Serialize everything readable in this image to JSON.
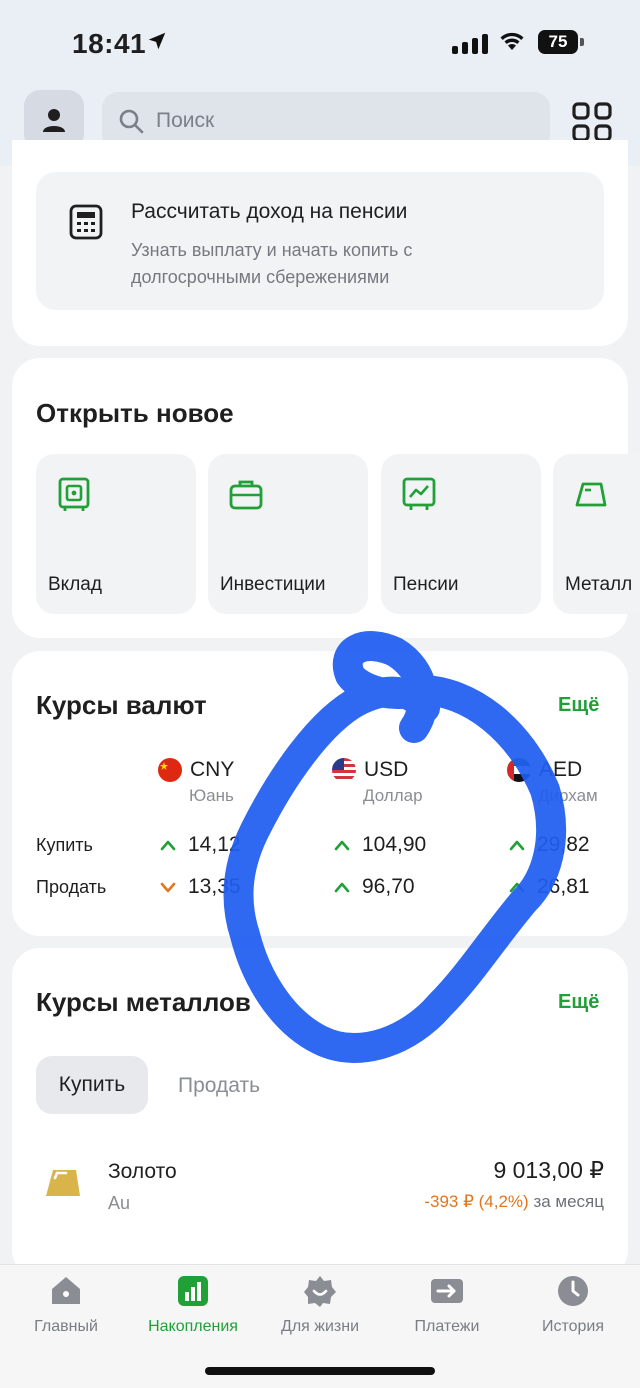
{
  "status_bar": {
    "time": "18:41",
    "battery": "75"
  },
  "header": {
    "search_placeholder": "Поиск"
  },
  "pension": {
    "title": "Рассчитать доход на пенсии",
    "subtitle": "Узнать выплату и начать копить с долгосрочными сбережениями"
  },
  "open_new": {
    "title": "Открыть новое",
    "tiles": [
      {
        "label": "Вклад",
        "icon": "safe-icon"
      },
      {
        "label": "Инвестиции",
        "icon": "briefcase-icon"
      },
      {
        "label": "Пенсии",
        "icon": "chart-icon"
      },
      {
        "label": "Металл",
        "icon": "ingot-icon"
      }
    ]
  },
  "fx": {
    "title": "Курсы валют",
    "more": "Ещё",
    "buy_label": "Купить",
    "sell_label": "Продать",
    "currencies": [
      {
        "code": "CNY",
        "name": "Юань",
        "buy": "14,12",
        "buy_trend": "up",
        "sell": "13,35",
        "sell_trend": "down"
      },
      {
        "code": "USD",
        "name": "Доллар",
        "buy": "104,90",
        "buy_trend": "up",
        "sell": "96,70",
        "sell_trend": "up"
      },
      {
        "code": "AED",
        "name": "Дирхам",
        "buy": "29,82",
        "buy_trend": "up",
        "sell": "26,81",
        "sell_trend": "up"
      }
    ],
    "colors": {
      "up": "#21a038",
      "down": "#e0761f"
    }
  },
  "metals": {
    "title": "Курсы металлов",
    "more": "Ещё",
    "segments": {
      "buy": "Купить",
      "sell": "Продать"
    },
    "items": [
      {
        "name": "Золото",
        "symbol": "Au",
        "price": "9 013,00 ₽",
        "change": "-393 ₽ (4,2%)",
        "period": "за месяц"
      }
    ]
  },
  "tabbar": {
    "tabs": [
      {
        "label": "Главный",
        "icon": "home-icon"
      },
      {
        "label": "Накопления",
        "icon": "savings-chart-icon"
      },
      {
        "label": "Для жизни",
        "icon": "lifestyle-icon"
      },
      {
        "label": "Платежи",
        "icon": "payments-arrow-icon"
      },
      {
        "label": "История",
        "icon": "clock-icon"
      }
    ],
    "active": "Накопления"
  },
  "colors": {
    "brand": "#21a038",
    "annotation": "#1f5cf0"
  }
}
